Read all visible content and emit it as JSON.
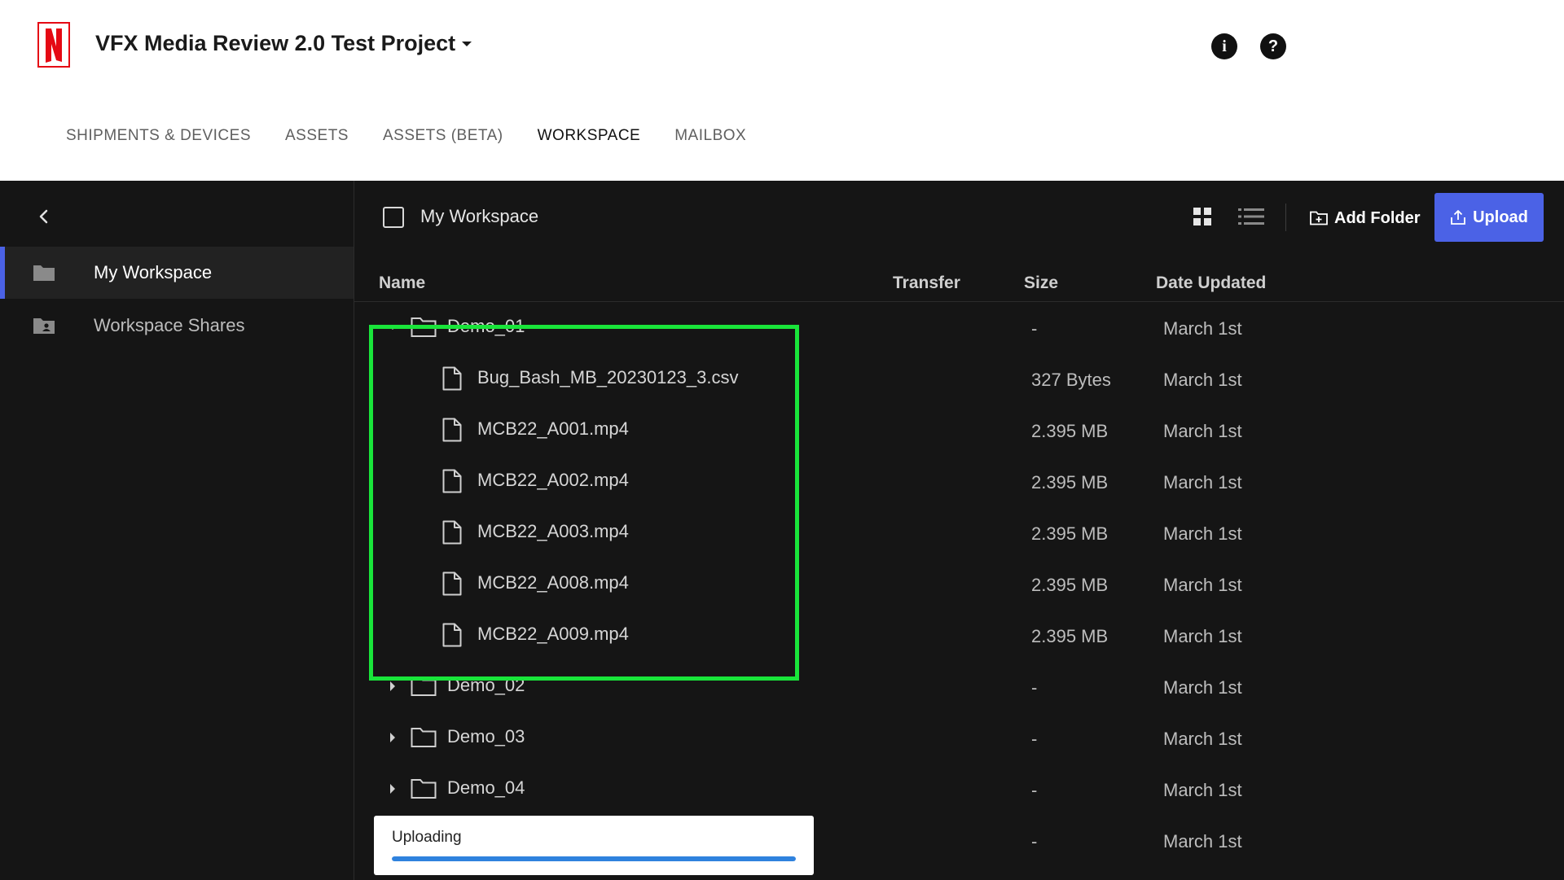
{
  "header": {
    "project_title": "VFX Media Review 2.0 Test Project",
    "info_icon": "i",
    "help_icon": "?",
    "tabs": [
      {
        "label": "SHIPMENTS & DEVICES",
        "active": false
      },
      {
        "label": "ASSETS",
        "active": false
      },
      {
        "label": "ASSETS (BETA)",
        "active": false
      },
      {
        "label": "WORKSPACE",
        "active": true
      },
      {
        "label": "MAILBOX",
        "active": false
      }
    ]
  },
  "sidebar": {
    "items": [
      {
        "label": "My Workspace",
        "icon": "folder-icon",
        "active": true
      },
      {
        "label": "Workspace Shares",
        "icon": "shared-folder-icon",
        "active": false
      }
    ]
  },
  "toolbar": {
    "title": "My Workspace",
    "add_folder_label": "Add Folder",
    "upload_label": "Upload"
  },
  "table": {
    "columns": [
      "Name",
      "Transfer",
      "Size",
      "Date Updated"
    ],
    "rows": [
      {
        "name": "Demo_01",
        "type": "folder",
        "expanded": true,
        "size": "-",
        "date": "March 1st"
      },
      {
        "name": "Bug_Bash_MB_20230123_3.csv",
        "type": "file",
        "size": "327 Bytes",
        "date": "March 1st"
      },
      {
        "name": "MCB22_A001.mp4",
        "type": "file",
        "size": "2.395 MB",
        "date": "March 1st"
      },
      {
        "name": "MCB22_A002.mp4",
        "type": "file",
        "size": "2.395 MB",
        "date": "March 1st"
      },
      {
        "name": "MCB22_A003.mp4",
        "type": "file",
        "size": "2.395 MB",
        "date": "March 1st"
      },
      {
        "name": "MCB22_A008.mp4",
        "type": "file",
        "size": "2.395 MB",
        "date": "March 1st"
      },
      {
        "name": "MCB22_A009.mp4",
        "type": "file",
        "size": "2.395 MB",
        "date": "March 1st"
      },
      {
        "name": "Demo_02",
        "type": "folder",
        "expanded": false,
        "size": "-",
        "date": "March 1st"
      },
      {
        "name": "Demo_03",
        "type": "folder",
        "expanded": false,
        "size": "-",
        "date": "March 1st"
      },
      {
        "name": "Demo_04",
        "type": "folder",
        "expanded": false,
        "size": "-",
        "date": "March 1st"
      },
      {
        "name": "",
        "type": "folder",
        "expanded": false,
        "size": "-",
        "date": "March 1st"
      }
    ]
  },
  "upload_toast": {
    "label": "Uploading",
    "progress": 1.0
  },
  "colors": {
    "accent": "#4b62e6",
    "highlight": "#19e53a",
    "progress": "#2f82de",
    "dark_bg": "#151515"
  }
}
